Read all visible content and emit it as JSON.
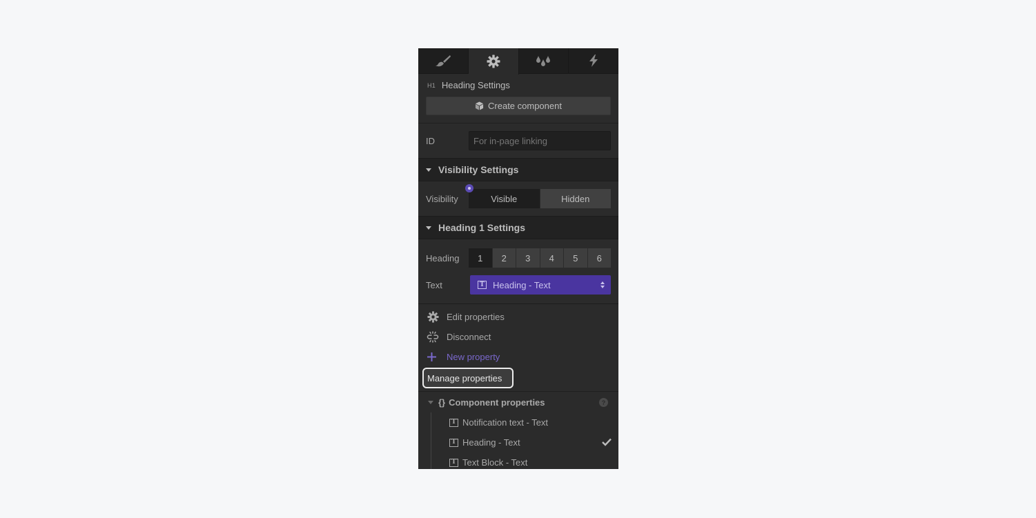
{
  "tabs": [
    {
      "name": "style",
      "icon": "paintbrush-icon",
      "active": false
    },
    {
      "name": "settings",
      "icon": "gear-icon",
      "active": true
    },
    {
      "name": "color-swatches",
      "icon": "droplets-icon",
      "active": false
    },
    {
      "name": "interactions",
      "icon": "lightning-icon",
      "active": false
    }
  ],
  "element": {
    "badge": "H1",
    "title": "Heading Settings",
    "create_component_label": "Create component"
  },
  "id_field": {
    "label": "ID",
    "placeholder": "For in-page linking",
    "value": ""
  },
  "visibility": {
    "section_title": "Visibility Settings",
    "label": "Visibility",
    "options": [
      "Visible",
      "Hidden"
    ],
    "selected": "Visible",
    "accent": "#5b4bb4"
  },
  "heading_settings": {
    "section_title": "Heading 1 Settings",
    "heading_label": "Heading",
    "levels": [
      "1",
      "2",
      "3",
      "4",
      "5",
      "6"
    ],
    "selected_level": "1",
    "text_label": "Text",
    "text_binding": "Heading - Text",
    "accent": "#4a35a0"
  },
  "dropdown": {
    "items": [
      {
        "label": "Edit properties",
        "icon": "gear-icon"
      },
      {
        "label": "Disconnect",
        "icon": "unlink-icon"
      },
      {
        "label": "New property",
        "icon": "plus-icon",
        "color": "#7a68cc"
      }
    ],
    "manage_label": "Manage properties",
    "group_title": "Component properties",
    "properties": [
      {
        "label": "Notification text - Text",
        "checked": false
      },
      {
        "label": "Heading - Text",
        "checked": true
      },
      {
        "label": "Text Block - Text",
        "checked": false
      }
    ]
  }
}
